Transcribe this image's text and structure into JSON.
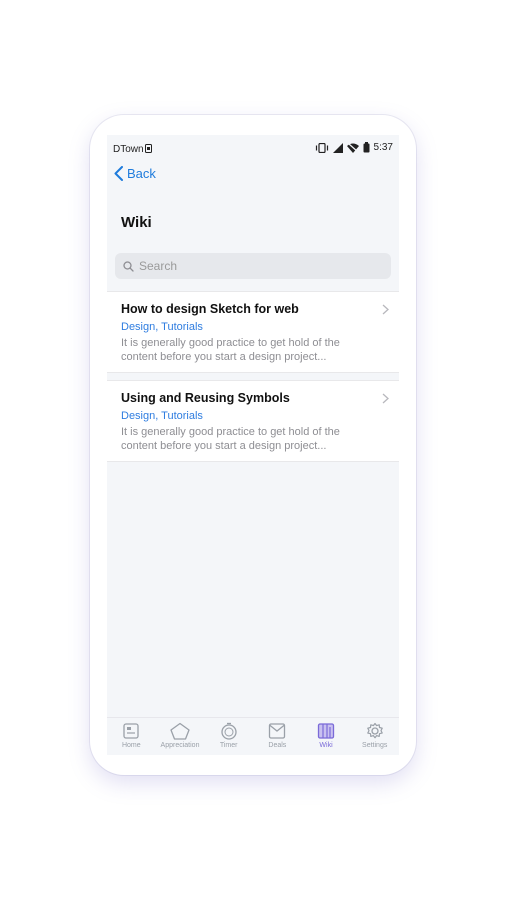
{
  "status_bar": {
    "carrier": "DTown",
    "time": "5:37"
  },
  "nav": {
    "back_label": "Back",
    "title": "Wiki"
  },
  "search": {
    "placeholder": "Search"
  },
  "articles": [
    {
      "title": "How to design Sketch for web",
      "tags": "Design, Tutorials",
      "excerpt": "It is generally good practice to get hold of the content before you start a design project..."
    },
    {
      "title": "Using and Reusing Symbols",
      "tags": "Design, Tutorials",
      "excerpt": "It is generally good practice to get hold of the content before you start a design project..."
    }
  ],
  "tabs": [
    {
      "label": "Home",
      "icon": "home-icon"
    },
    {
      "label": "Appreciation",
      "icon": "pentagon-icon"
    },
    {
      "label": "Timer",
      "icon": "timer-icon"
    },
    {
      "label": "Deals",
      "icon": "envelope-icon"
    },
    {
      "label": "Wiki",
      "icon": "book-icon",
      "active": true
    },
    {
      "label": "Settings",
      "icon": "gear-icon"
    }
  ],
  "colors": {
    "accent": "#1e7bdc",
    "active_tab": "#7a6ad8",
    "tag": "#2f7de0",
    "background": "#f4f6f9"
  }
}
